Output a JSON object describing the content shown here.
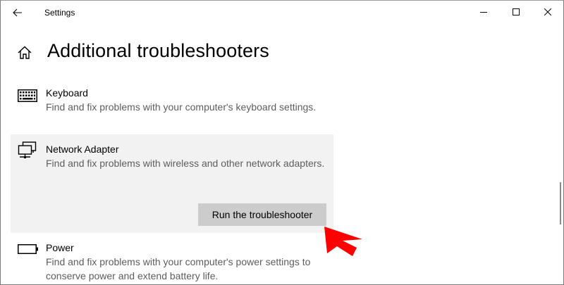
{
  "window": {
    "title": "Settings"
  },
  "page": {
    "title": "Additional troubleshooters"
  },
  "troubleshooters": [
    {
      "title": "Keyboard",
      "description": "Find and fix problems with your computer's keyboard settings.",
      "icon": "keyboard-icon"
    },
    {
      "title": "Network Adapter",
      "description": "Find and fix problems with wireless and other network adapters.",
      "icon": "network-adapter-icon",
      "action_label": "Run the troubleshooter"
    },
    {
      "title": "Power",
      "description": "Find and fix problems with your computer's power settings to conserve power and extend battery life.",
      "icon": "battery-icon"
    }
  ],
  "colors": {
    "selected_item_bg": "#f2f2f2",
    "button_bg": "#cccccc",
    "description_text": "#5d5d5d",
    "pointer_arrow": "#ff0000"
  }
}
